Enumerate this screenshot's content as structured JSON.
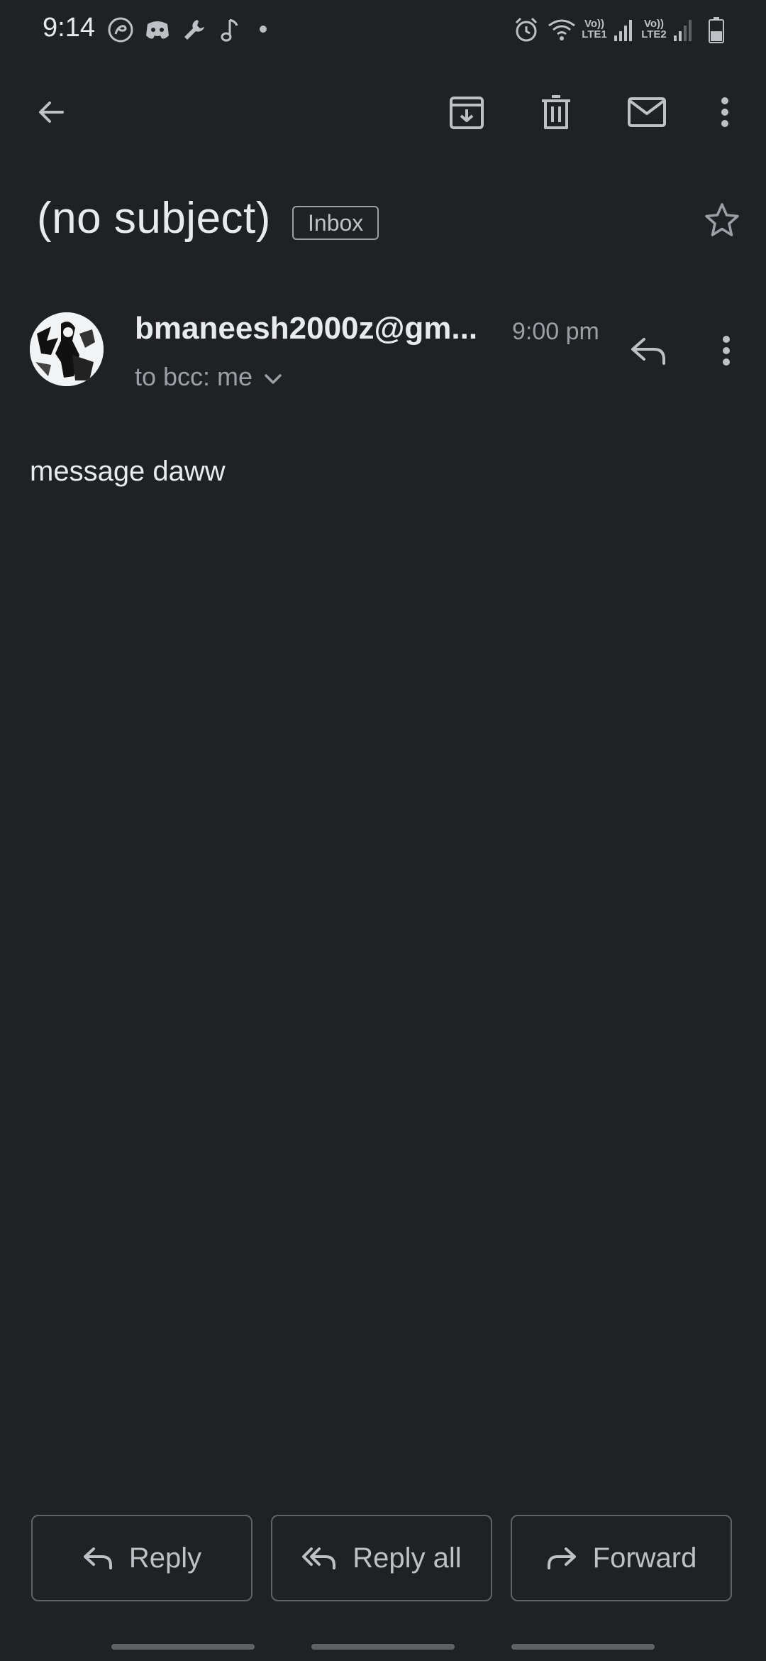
{
  "status_bar": {
    "time": "9:14",
    "left_icons": [
      "airtel-icon",
      "discord-icon",
      "wrench-icon",
      "music-note-icon"
    ],
    "right_icons": [
      "alarm-icon",
      "wifi-icon",
      "signal-lte1-icon",
      "signal-lte2-icon",
      "battery-icon"
    ],
    "sim1_label": "Vo)) LTE1",
    "sim2_label": "Vo)) LTE2"
  },
  "app_bar": {
    "actions": [
      "back-arrow-icon",
      "archive-icon",
      "delete-icon",
      "mark-unread-icon",
      "overflow-menu-icon"
    ]
  },
  "message": {
    "subject": "(no subject)",
    "label": "Inbox",
    "sender": "bmaneesh2000z@gm...",
    "time": "9:00 pm",
    "recipients": "to bcc: me",
    "body": "message daww"
  },
  "actions": {
    "reply": "Reply",
    "reply_all": "Reply all",
    "forward": "Forward"
  },
  "colors": {
    "background": "#202124",
    "text_primary": "#e8eaed",
    "text_secondary": "#9aa0a6",
    "border": "#5f6368"
  }
}
